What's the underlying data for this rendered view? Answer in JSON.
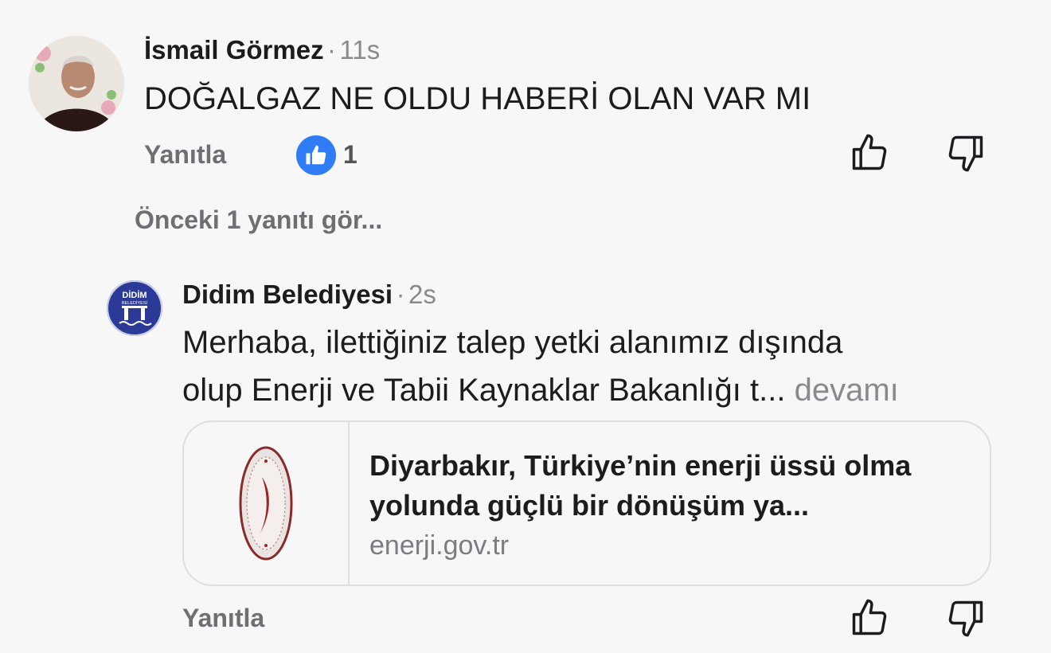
{
  "comment": {
    "author": "İsmail Görmez",
    "separator": "·",
    "time": "11s",
    "text": "DOĞALGAZ NE OLDU HABERİ OLAN VAR MI",
    "reply_label": "Yanıtla",
    "like_count": "1",
    "avatar_icon": "user-photo-avatar",
    "like_icon": "thumbs-up-badge-icon"
  },
  "previous_replies_label": "Önceki 1 yanıtı gör...",
  "reply": {
    "author": "Didim Belediyesi",
    "separator": "·",
    "time": "2s",
    "line1": "Merhaba, ilettiğiniz talep yetki alanımız dışında",
    "line2": "olup Enerji ve Tabii Kaynaklar Bakanlığı t...",
    "more_label": "devamı",
    "reply_label": "Yanıtla",
    "avatar": {
      "line1": "DİDİM",
      "line2": "BELEDİYESİ"
    },
    "link": {
      "title": "Diyarbakır, Türkiye’nin enerji üssü olma yolunda güçlü bir dönüşüm ya...",
      "domain": "enerji.gov.tr",
      "thumbnail_icon": "ministry-seal-icon"
    }
  },
  "icons": {
    "upvote": "thumbs-up-outline-icon",
    "downvote": "thumbs-down-outline-icon"
  },
  "colors": {
    "background": "#f7f7f8",
    "like_badge": "#2e7cf6",
    "muted_text": "#8a8a8e",
    "avatar_blue": "#2c3a97",
    "seal_red": "#8b2a2a"
  }
}
